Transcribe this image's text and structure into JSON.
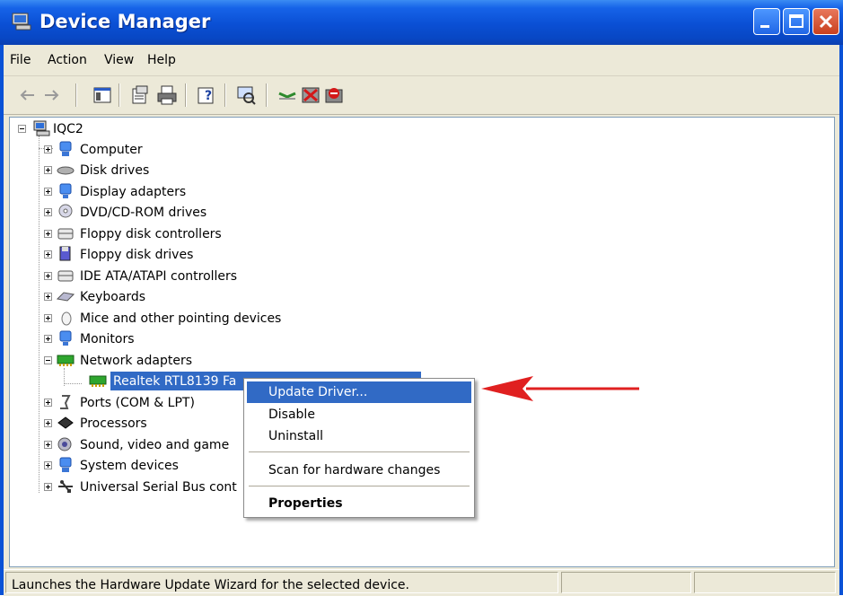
{
  "window": {
    "title": "Device Manager",
    "accent": "#0a4fd4"
  },
  "menu": [
    "File",
    "Action",
    "View",
    "Help"
  ],
  "toolbar": {
    "icons": [
      "back-arrow-icon",
      "forward-arrow-icon",
      "show-hide-console-tree-icon",
      "properties-icon",
      "print-icon",
      "help-icon",
      "scan-hardware-icon",
      "update-driver-icon",
      "uninstall-icon",
      "disable-icon"
    ]
  },
  "tree": {
    "root": "IQC2",
    "categories": [
      "Computer",
      "Disk drives",
      "Display adapters",
      "DVD/CD-ROM drives",
      "Floppy disk controllers",
      "Floppy disk drives",
      "IDE ATA/ATAPI controllers",
      "Keyboards",
      "Mice and other pointing devices",
      "Monitors",
      "Network adapters",
      "Realtek RTL8139 Fa",
      "Ports (COM & LPT)",
      "Processors",
      "Sound, video and game",
      "System devices",
      "Universal Serial Bus cont"
    ]
  },
  "context_menu": {
    "items": [
      "Update Driver...",
      "Disable",
      "Uninstall",
      "Scan for hardware changes",
      "Properties"
    ]
  },
  "status": {
    "text": "Launches the Hardware Update Wizard for the selected device."
  }
}
